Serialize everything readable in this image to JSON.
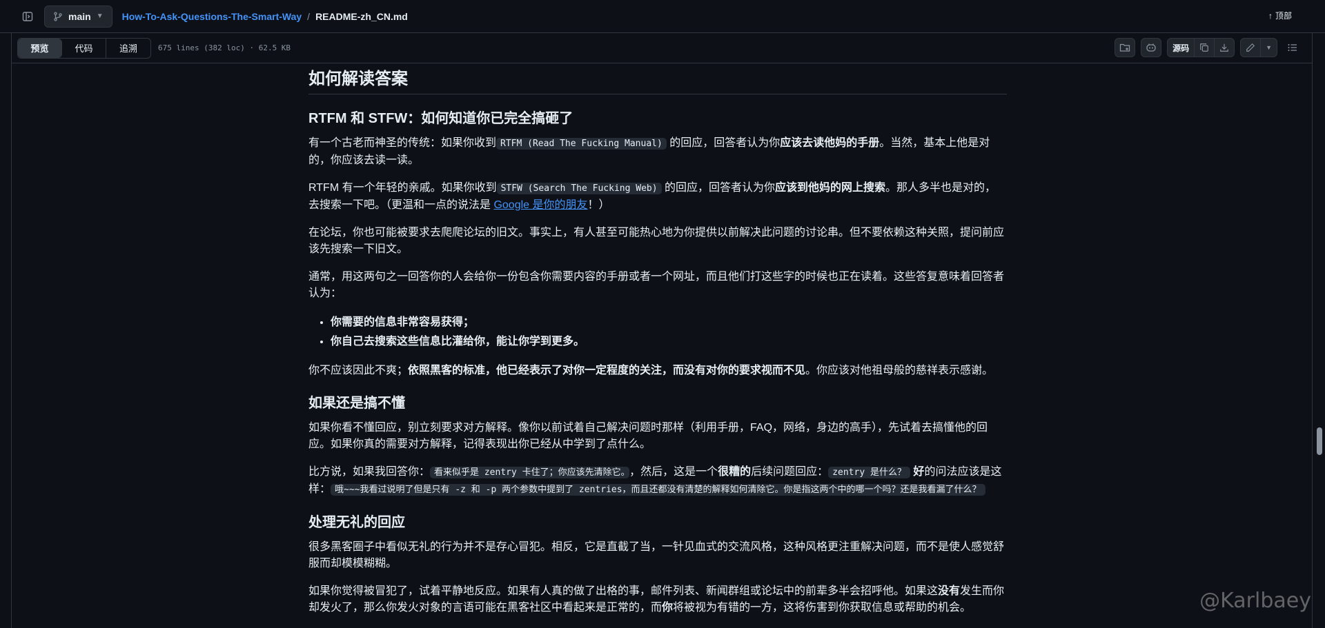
{
  "header": {
    "branch": "main",
    "repo": "How-To-Ask-Questions-The-Smart-Way",
    "separator": "/",
    "file": "README-zh_CN.md",
    "top_link": "顶部"
  },
  "filebar": {
    "tabs": [
      "预览",
      "代码",
      "追溯"
    ],
    "meta": "675 lines (382 loc) · 62.5 KB",
    "raw_label": "源码"
  },
  "article": {
    "h2": "如何解读答案",
    "s1_title": "RTFM 和 STFW：如何知道你已完全搞砸了",
    "p1_a": "有一个古老而神圣的传统：如果你收到",
    "p1_code": "RTFM (Read The Fucking Manual)",
    "p1_b": " 的回应，回答者认为你",
    "p1_strong": "应该去读他妈的手册",
    "p1_c": "。当然，基本上他是对的，你应该去读一读。",
    "p2_a": "RTFM 有一个年轻的亲戚。如果你收到",
    "p2_code": "STFW (Search The Fucking Web)",
    "p2_b": " 的回应，回答者认为你",
    "p2_strong": "应该到他妈的网上搜索",
    "p2_c": "。那人多半也是对的，去搜索一下吧。（更温和一点的说法是 ",
    "p2_link": "Google 是你的朋友",
    "p2_d": "！）",
    "p3": "在论坛，你也可能被要求去爬爬论坛的旧文。事实上，有人甚至可能热心地为你提供以前解决此问题的讨论串。但不要依赖这种关照，提问前应该先搜索一下旧文。",
    "p4": "通常，用这两句之一回答你的人会给你一份包含你需要内容的手册或者一个网址，而且他们打这些字的时候也正在读着。这些答复意味着回答者认为：",
    "list": [
      "你需要的信息非常容易获得；",
      "你自己去搜索这些信息比灌给你，能让你学到更多。"
    ],
    "p5_a": "你不应该因此不爽；",
    "p5_strong": "依照黑客的标准，他已经表示了对你一定程度的关注，而没有对你的要求视而不见",
    "p5_b": "。你应该对他祖母般的慈祥表示感谢。",
    "s2_title": "如果还是搞不懂",
    "p6": "如果你看不懂回应，别立刻要求对方解释。像你以前试着自己解决问题时那样（利用手册，FAQ，网络，身边的高手），先试着去搞懂他的回应。如果你真的需要对方解释，记得表现出你已经从中学到了点什么。",
    "p7_a": "比方说，如果我回答你：",
    "p7_code1": "看来似乎是 zentry 卡住了；你应该先清除它。",
    "p7_b": "，然后，这是一个",
    "p7_strong1": "很糟的",
    "p7_c": "后续问题回应：",
    "p7_code2": "zentry 是什么？",
    "p7_strong2": " 好",
    "p7_d": "的问法应该是这样：",
    "p7_code3": "哦~~~我看过说明了但是只有 -z 和 -p 两个参数中提到了 zentries，而且还都没有清楚的解释如何清除它。你是指这两个中的哪一个吗？还是我看漏了什么？",
    "s3_title": "处理无礼的回应",
    "p8": "很多黑客圈子中看似无礼的行为并不是存心冒犯。相反，它是直截了当，一针见血式的交流风格，这种风格更注重解决问题，而不是使人感觉舒服而却模模糊糊。",
    "p9_a": "如果你觉得被冒犯了，试着平静地反应。如果有人真的做了出格的事，邮件列表、新闻群组或论坛中的前辈多半会招呼他。如果这",
    "p9_strong": "没有",
    "p9_b": "发生而你却发火了，那么你发火对象的言语可能在黑客社区中看起来是正常的，而",
    "p9_strong2": "你",
    "p9_c": "将被视为有错的一方，这将伤害到你获取信息或帮助的机会。"
  },
  "watermark": "@Karlbaey"
}
